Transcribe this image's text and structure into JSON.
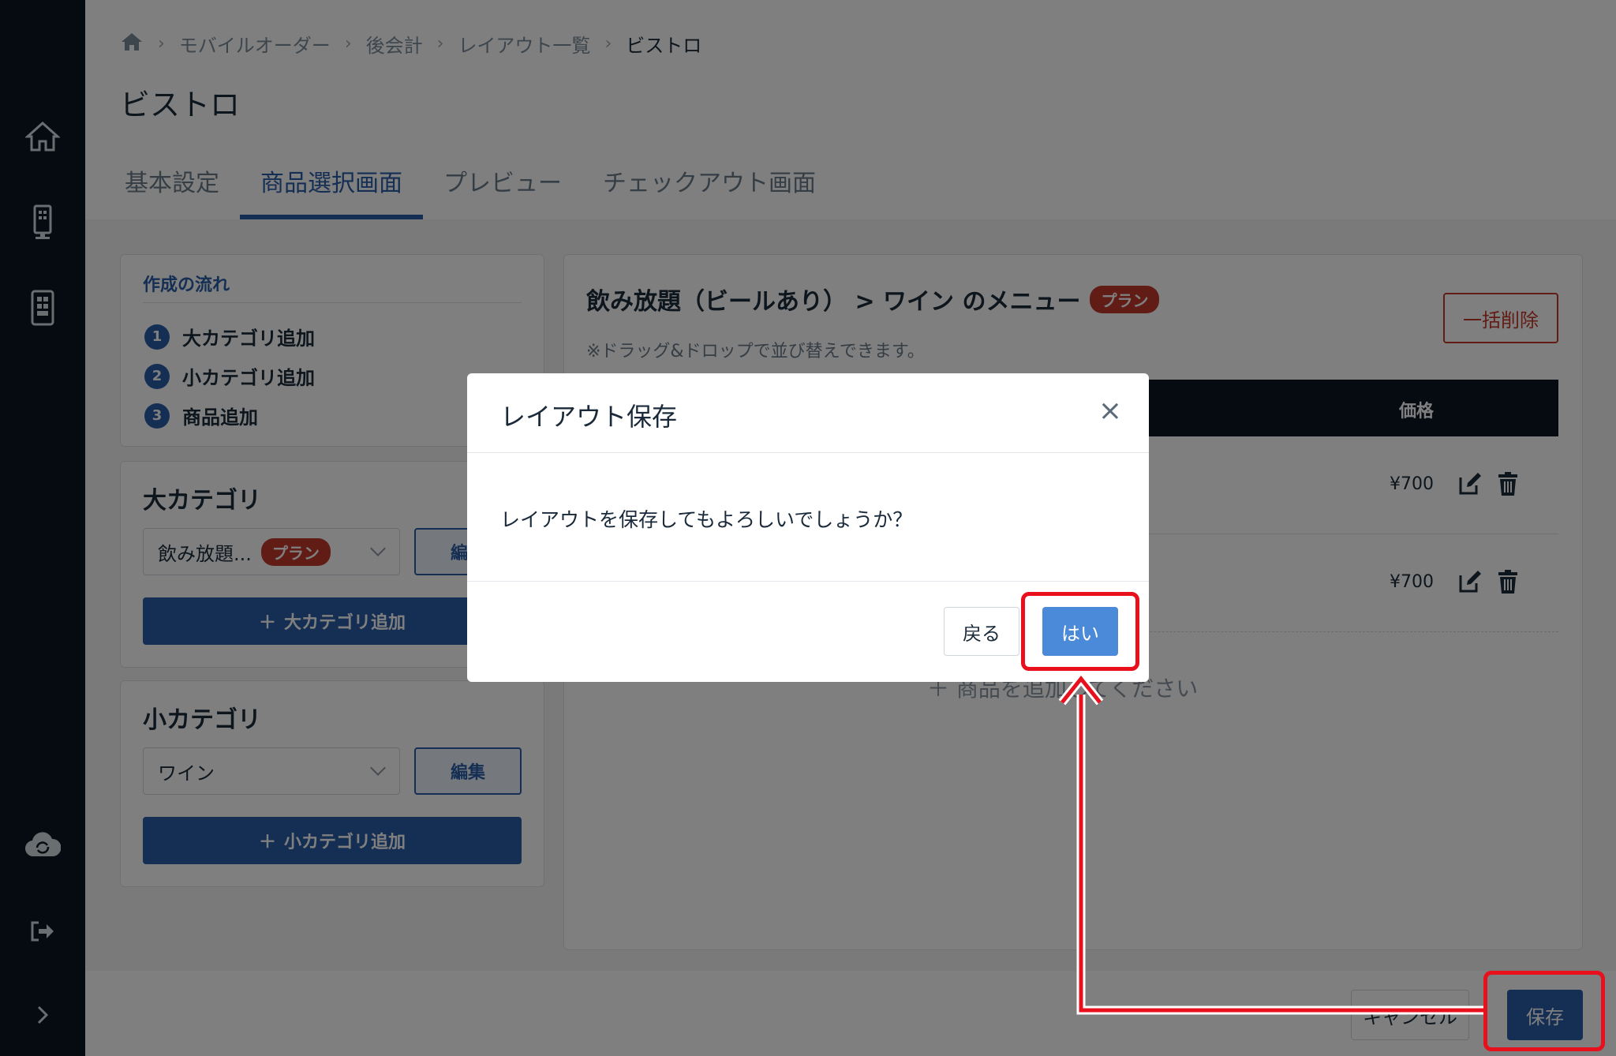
{
  "breadcrumb": {
    "items": [
      "モバイルオーダー",
      "後会計",
      "レイアウト一覧"
    ],
    "current": "ビストロ"
  },
  "page": {
    "title": "ビストロ"
  },
  "tabs": [
    {
      "label": "基本設定"
    },
    {
      "label": "商品選択画面",
      "active": true
    },
    {
      "label": "プレビュー"
    },
    {
      "label": "チェックアウト画面"
    }
  ],
  "flow": {
    "title": "作成の流れ",
    "steps": [
      {
        "num": "1",
        "label": "大カテゴリ追加"
      },
      {
        "num": "2",
        "label": "小カテゴリ追加"
      },
      {
        "num": "3",
        "label": "商品追加"
      }
    ]
  },
  "large_category": {
    "heading": "大カテゴリ",
    "selected": "飲み放題...",
    "badge": "プラン",
    "edit_label": "編集",
    "add_label": "大カテゴリ追加"
  },
  "small_category": {
    "heading": "小カテゴリ",
    "selected": "ワイン",
    "edit_label": "編集",
    "add_label": "小カテゴリ追加"
  },
  "menu": {
    "title": "飲み放題（ビールあり） > ワイン のメニュー",
    "badge": "プラン",
    "hint": "※ドラッグ&ドロップで並び替えできます。",
    "bulk_delete": "一括削除",
    "col_price": "価格",
    "rows": [
      {
        "price": "¥700"
      },
      {
        "price": "¥700"
      }
    ],
    "add_item": "＋ 商品を追加してください"
  },
  "footer": {
    "cancel_label": "キャンセル",
    "save_label": "保存"
  },
  "modal": {
    "title": "レイアウト保存",
    "close": "×",
    "message": "レイアウトを保存してもよろしいでしょうか？",
    "back_label": "戻る",
    "yes_label": "はい"
  },
  "colors": {
    "sidebar": "#0b1722",
    "accent": "#2a5fa8",
    "danger": "#c0392b",
    "highlight": "#e8101c"
  }
}
